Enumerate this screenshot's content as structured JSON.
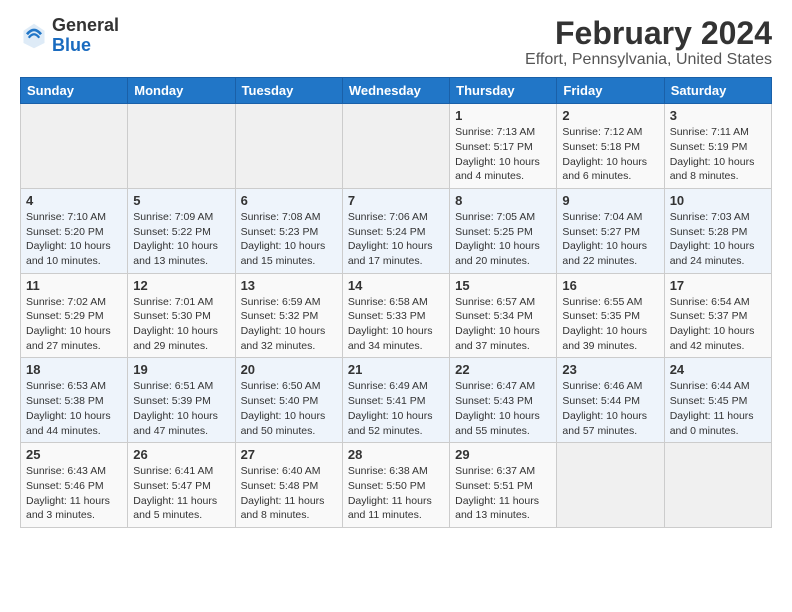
{
  "header": {
    "logo_general": "General",
    "logo_blue": "Blue",
    "title": "February 2024",
    "subtitle": "Effort, Pennsylvania, United States"
  },
  "weekdays": [
    "Sunday",
    "Monday",
    "Tuesday",
    "Wednesday",
    "Thursday",
    "Friday",
    "Saturday"
  ],
  "weeks": [
    [
      {
        "day": "",
        "info": ""
      },
      {
        "day": "",
        "info": ""
      },
      {
        "day": "",
        "info": ""
      },
      {
        "day": "",
        "info": ""
      },
      {
        "day": "1",
        "info": "Sunrise: 7:13 AM\nSunset: 5:17 PM\nDaylight: 10 hours\nand 4 minutes."
      },
      {
        "day": "2",
        "info": "Sunrise: 7:12 AM\nSunset: 5:18 PM\nDaylight: 10 hours\nand 6 minutes."
      },
      {
        "day": "3",
        "info": "Sunrise: 7:11 AM\nSunset: 5:19 PM\nDaylight: 10 hours\nand 8 minutes."
      }
    ],
    [
      {
        "day": "4",
        "info": "Sunrise: 7:10 AM\nSunset: 5:20 PM\nDaylight: 10 hours\nand 10 minutes."
      },
      {
        "day": "5",
        "info": "Sunrise: 7:09 AM\nSunset: 5:22 PM\nDaylight: 10 hours\nand 13 minutes."
      },
      {
        "day": "6",
        "info": "Sunrise: 7:08 AM\nSunset: 5:23 PM\nDaylight: 10 hours\nand 15 minutes."
      },
      {
        "day": "7",
        "info": "Sunrise: 7:06 AM\nSunset: 5:24 PM\nDaylight: 10 hours\nand 17 minutes."
      },
      {
        "day": "8",
        "info": "Sunrise: 7:05 AM\nSunset: 5:25 PM\nDaylight: 10 hours\nand 20 minutes."
      },
      {
        "day": "9",
        "info": "Sunrise: 7:04 AM\nSunset: 5:27 PM\nDaylight: 10 hours\nand 22 minutes."
      },
      {
        "day": "10",
        "info": "Sunrise: 7:03 AM\nSunset: 5:28 PM\nDaylight: 10 hours\nand 24 minutes."
      }
    ],
    [
      {
        "day": "11",
        "info": "Sunrise: 7:02 AM\nSunset: 5:29 PM\nDaylight: 10 hours\nand 27 minutes."
      },
      {
        "day": "12",
        "info": "Sunrise: 7:01 AM\nSunset: 5:30 PM\nDaylight: 10 hours\nand 29 minutes."
      },
      {
        "day": "13",
        "info": "Sunrise: 6:59 AM\nSunset: 5:32 PM\nDaylight: 10 hours\nand 32 minutes."
      },
      {
        "day": "14",
        "info": "Sunrise: 6:58 AM\nSunset: 5:33 PM\nDaylight: 10 hours\nand 34 minutes."
      },
      {
        "day": "15",
        "info": "Sunrise: 6:57 AM\nSunset: 5:34 PM\nDaylight: 10 hours\nand 37 minutes."
      },
      {
        "day": "16",
        "info": "Sunrise: 6:55 AM\nSunset: 5:35 PM\nDaylight: 10 hours\nand 39 minutes."
      },
      {
        "day": "17",
        "info": "Sunrise: 6:54 AM\nSunset: 5:37 PM\nDaylight: 10 hours\nand 42 minutes."
      }
    ],
    [
      {
        "day": "18",
        "info": "Sunrise: 6:53 AM\nSunset: 5:38 PM\nDaylight: 10 hours\nand 44 minutes."
      },
      {
        "day": "19",
        "info": "Sunrise: 6:51 AM\nSunset: 5:39 PM\nDaylight: 10 hours\nand 47 minutes."
      },
      {
        "day": "20",
        "info": "Sunrise: 6:50 AM\nSunset: 5:40 PM\nDaylight: 10 hours\nand 50 minutes."
      },
      {
        "day": "21",
        "info": "Sunrise: 6:49 AM\nSunset: 5:41 PM\nDaylight: 10 hours\nand 52 minutes."
      },
      {
        "day": "22",
        "info": "Sunrise: 6:47 AM\nSunset: 5:43 PM\nDaylight: 10 hours\nand 55 minutes."
      },
      {
        "day": "23",
        "info": "Sunrise: 6:46 AM\nSunset: 5:44 PM\nDaylight: 10 hours\nand 57 minutes."
      },
      {
        "day": "24",
        "info": "Sunrise: 6:44 AM\nSunset: 5:45 PM\nDaylight: 11 hours\nand 0 minutes."
      }
    ],
    [
      {
        "day": "25",
        "info": "Sunrise: 6:43 AM\nSunset: 5:46 PM\nDaylight: 11 hours\nand 3 minutes."
      },
      {
        "day": "26",
        "info": "Sunrise: 6:41 AM\nSunset: 5:47 PM\nDaylight: 11 hours\nand 5 minutes."
      },
      {
        "day": "27",
        "info": "Sunrise: 6:40 AM\nSunset: 5:48 PM\nDaylight: 11 hours\nand 8 minutes."
      },
      {
        "day": "28",
        "info": "Sunrise: 6:38 AM\nSunset: 5:50 PM\nDaylight: 11 hours\nand 11 minutes."
      },
      {
        "day": "29",
        "info": "Sunrise: 6:37 AM\nSunset: 5:51 PM\nDaylight: 11 hours\nand 13 minutes."
      },
      {
        "day": "",
        "info": ""
      },
      {
        "day": "",
        "info": ""
      }
    ]
  ]
}
